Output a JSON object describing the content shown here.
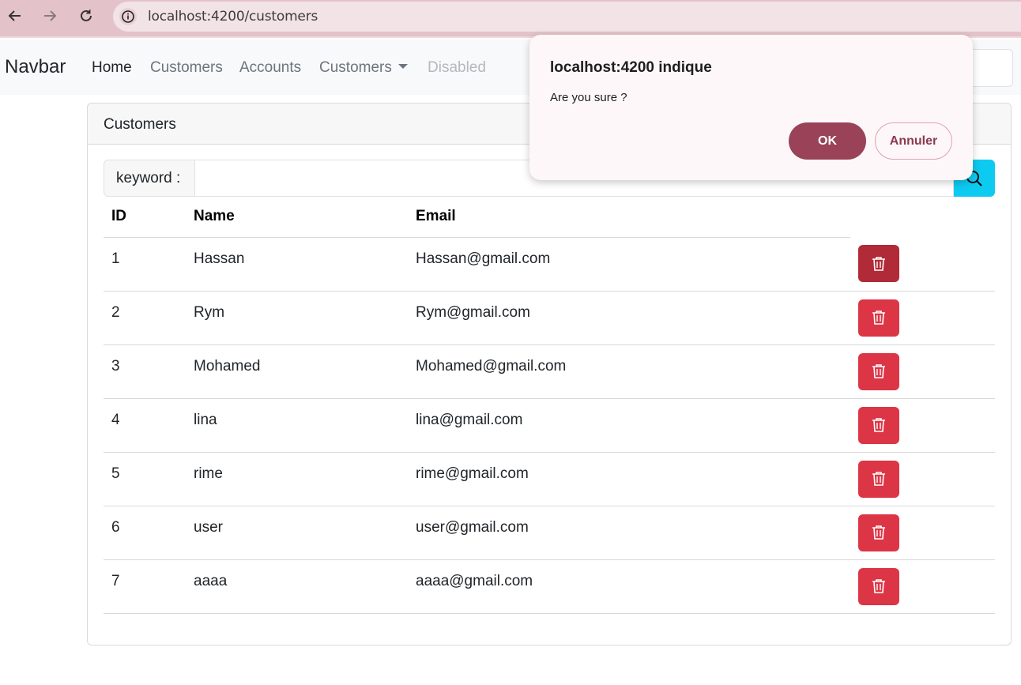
{
  "browser": {
    "url": "localhost:4200/customers"
  },
  "navbar": {
    "brand": "Navbar",
    "links": [
      "Home",
      "Customers",
      "Accounts"
    ],
    "dropdown": "Customers",
    "disabled": "Disabled"
  },
  "card": {
    "header": "Customers",
    "search_label": "keyword :",
    "search_value": "",
    "columns": [
      "ID",
      "Name",
      "Email"
    ],
    "rows": [
      {
        "id": "1",
        "name": "Hassan",
        "email": "Hassan@gmail.com"
      },
      {
        "id": "2",
        "name": "Rym",
        "email": "Rym@gmail.com"
      },
      {
        "id": "3",
        "name": "Mohamed",
        "email": "Mohamed@gmail.com"
      },
      {
        "id": "4",
        "name": "lina",
        "email": "lina@gmail.com"
      },
      {
        "id": "5",
        "name": "rime",
        "email": "rime@gmail.com"
      },
      {
        "id": "6",
        "name": "user",
        "email": "user@gmail.com"
      },
      {
        "id": "7",
        "name": "aaaa",
        "email": "aaaa@gmail.com"
      }
    ]
  },
  "dialog": {
    "title": "localhost:4200 indique",
    "message": "Are you sure ?",
    "ok_label": "OK",
    "cancel_label": "Annuler"
  },
  "icons": {
    "back": "arrow-left-icon",
    "forward": "arrow-right-icon",
    "reload": "reload-icon",
    "site_info": "info-icon",
    "search": "search-icon",
    "delete": "trash-icon"
  },
  "colors": {
    "danger": "#dc3545",
    "danger_pressed": "#b02a37",
    "info": "#0dcaf0",
    "dialog_ok": "#9a4258"
  }
}
